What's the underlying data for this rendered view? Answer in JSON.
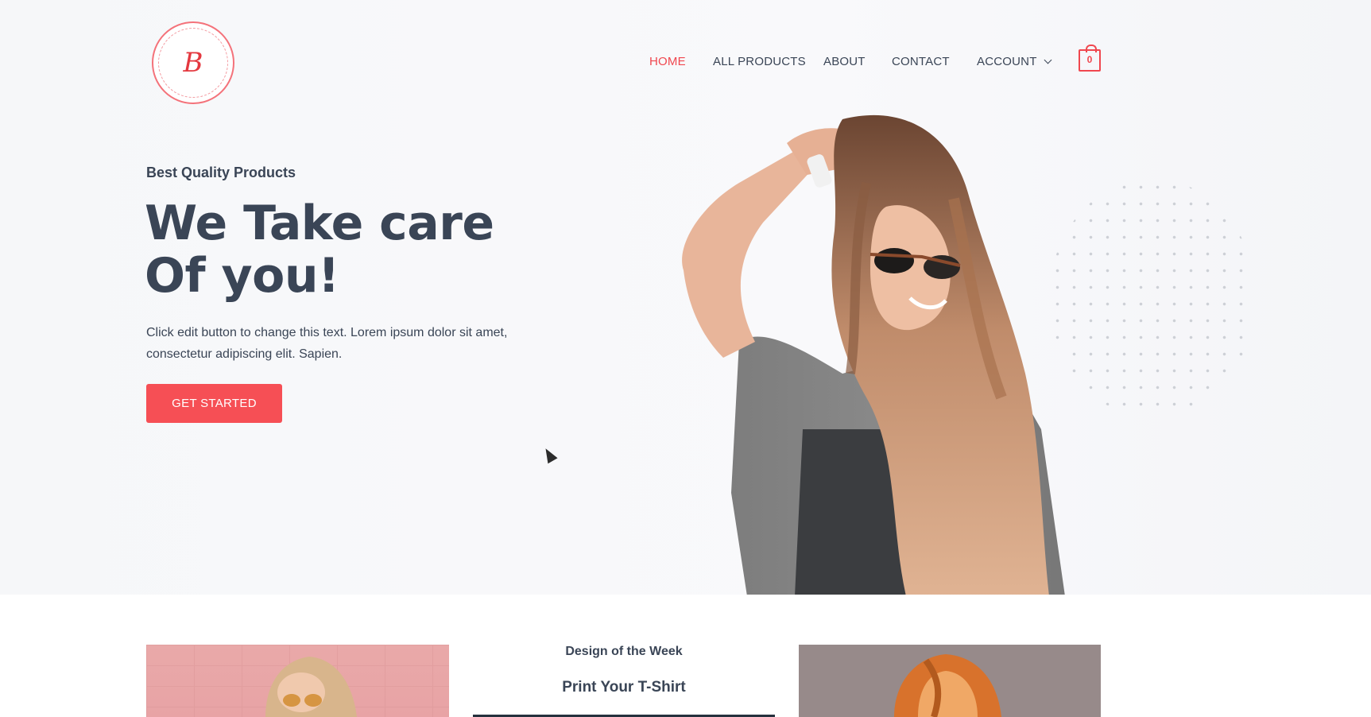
{
  "brand": {
    "logo_letter": "B",
    "accent": "#f0474f"
  },
  "nav": {
    "items": [
      {
        "label": "HOME",
        "active": true
      },
      {
        "label": "ALL PRODUCTS",
        "active": false
      },
      {
        "label": "ABOUT",
        "active": false
      },
      {
        "label": "CONTACT",
        "active": false
      },
      {
        "label": "ACCOUNT",
        "active": false,
        "has_dropdown": true
      }
    ],
    "cart_count": "0",
    "cart_icon": "shopping-bag-icon"
  },
  "hero": {
    "eyebrow": "Best Quality Products",
    "headline_line1": "We Take care",
    "headline_line2": "Of you!",
    "lead": "Click edit button to change this text. Lorem ipsum dolor sit amet, consectetur adipiscing elit. Sapien.",
    "cta_label": "GET STARTED",
    "cta_color": "#f64f55",
    "image": "woman-with-sunglasses-photo"
  },
  "featured": {
    "left_image": "woman-pink-wall-photo",
    "eyebrow": "Design of the Week",
    "title": "Print Your T-Shirt",
    "right_image": "redhead-woman-photo"
  }
}
